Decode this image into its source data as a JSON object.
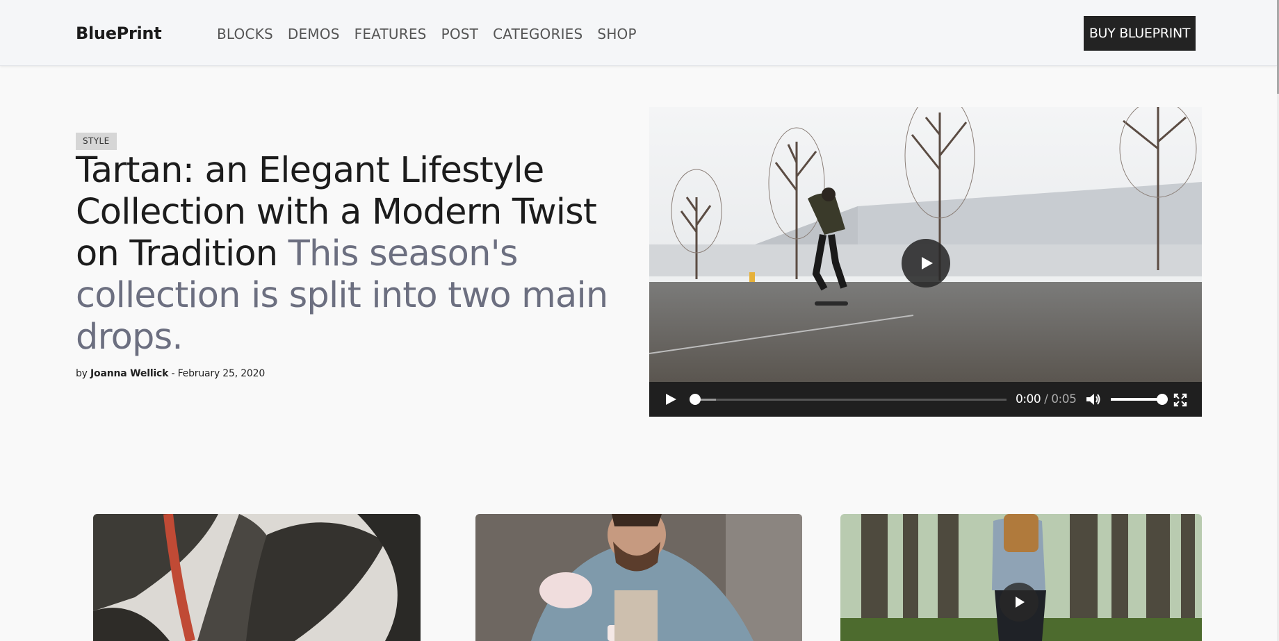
{
  "header": {
    "logo": "BluePrint",
    "nav": [
      "BLOCKS",
      "DEMOS",
      "FEATURES",
      "POST",
      "CATEGORIES",
      "SHOP"
    ],
    "cta_label": "BUY BLUEPRINT"
  },
  "hero": {
    "category_badge": "STYLE",
    "title": "Tartan: an Elegant Lifestyle Collection with a Modern Twist on Tradition",
    "excerpt": "This season's collection is split into two main drops.",
    "byline_prefix": "by",
    "author": "Joanna Wellick",
    "byline_sep": " - ",
    "date": "February 25, 2020"
  },
  "video": {
    "current_time": "0:00",
    "time_separator": " / ",
    "duration": "0:05",
    "progress_fraction": 0.0,
    "volume_fraction": 1.0,
    "icons": [
      "play-icon",
      "volume-icon",
      "fullscreen-icon"
    ]
  },
  "cards": [
    {
      "image": "rubber-plant-leaves"
    },
    {
      "image": "man-pouring-tea"
    },
    {
      "image": "hiker-in-forest",
      "has_video": true
    }
  ],
  "colors": {
    "accent_dark": "#232323",
    "excerpt_gray": "#6c6f80",
    "page_bg": "#f9f9f9"
  }
}
